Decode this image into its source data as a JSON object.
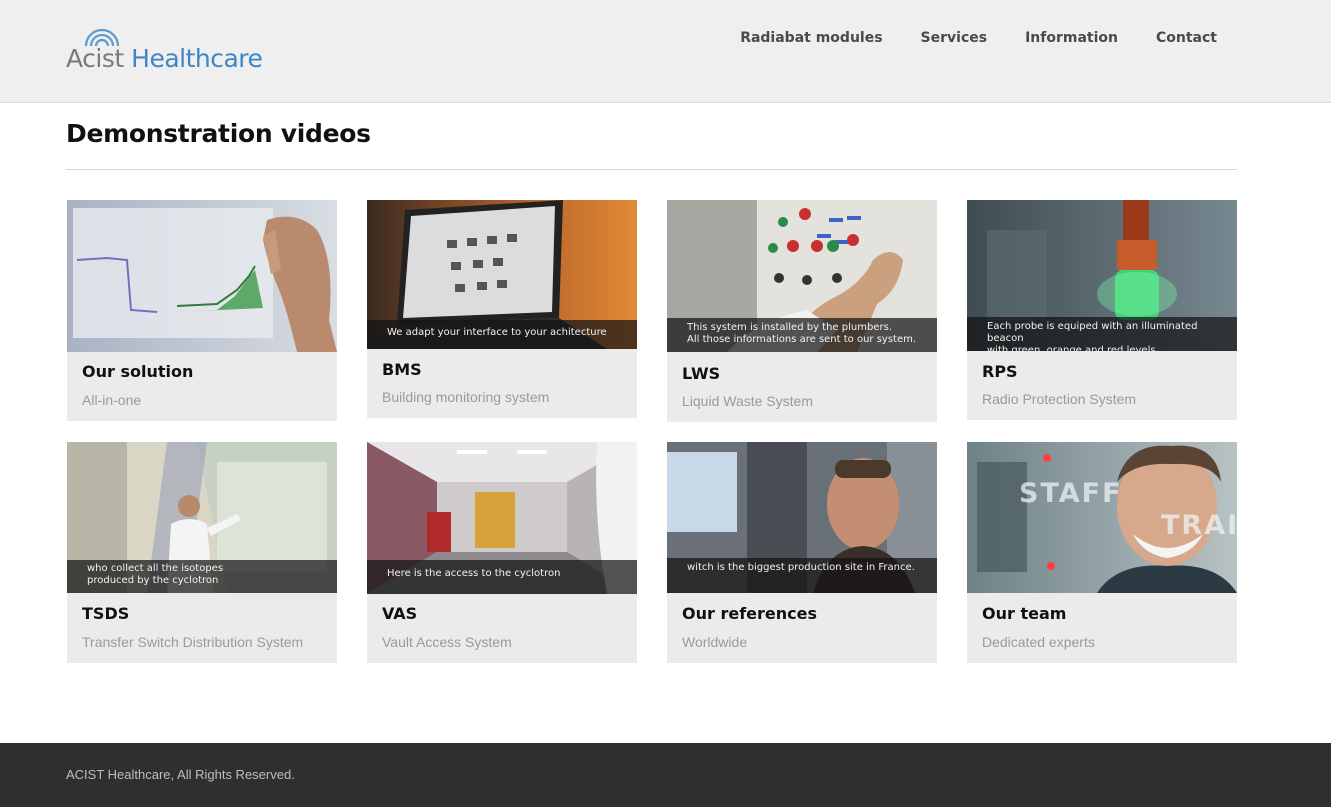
{
  "brand": {
    "part1": "Acist",
    "part2": "Healthcare"
  },
  "nav": {
    "items": [
      {
        "label": "Radiabat modules"
      },
      {
        "label": "Services"
      },
      {
        "label": "Information"
      },
      {
        "label": "Contact"
      }
    ]
  },
  "page": {
    "title": "Demonstration videos"
  },
  "videos": [
    {
      "title": "Our solution",
      "subtitle": "All-in-one",
      "caption": ""
    },
    {
      "title": "BMS",
      "subtitle": "Building monitoring system",
      "caption": "We adapt your interface to your achitecture"
    },
    {
      "title": "LWS",
      "subtitle": "Liquid Waste System",
      "caption": "This system is installed by the plumbers.\nAll those informations are sent to our system."
    },
    {
      "title": "RPS",
      "subtitle": "Radio Protection System",
      "caption": "Each probe is equiped with an illuminated beacon\nwith green, orange and red levels"
    },
    {
      "title": "TSDS",
      "subtitle": "Transfer Switch Distribution System",
      "caption": "who collect all the isotopes\nproduced by the cyclotron"
    },
    {
      "title": "VAS",
      "subtitle": "Vault Access System",
      "caption": "Here is the access to the cyclotron"
    },
    {
      "title": "Our references",
      "subtitle": "Worldwide",
      "caption": "witch is the biggest production site in France."
    },
    {
      "title": "Our team",
      "subtitle": "Dedicated experts",
      "caption": "",
      "overlay_text_1": "STAFF",
      "overlay_text_2": "TRAIN"
    }
  ],
  "footer": {
    "text": "ACIST Healthcare, All Rights Reserved."
  },
  "colors": {
    "brand_blue": "#3f86c4",
    "footer_bg": "#2f2f2f",
    "card_bg": "#ebebeb"
  }
}
